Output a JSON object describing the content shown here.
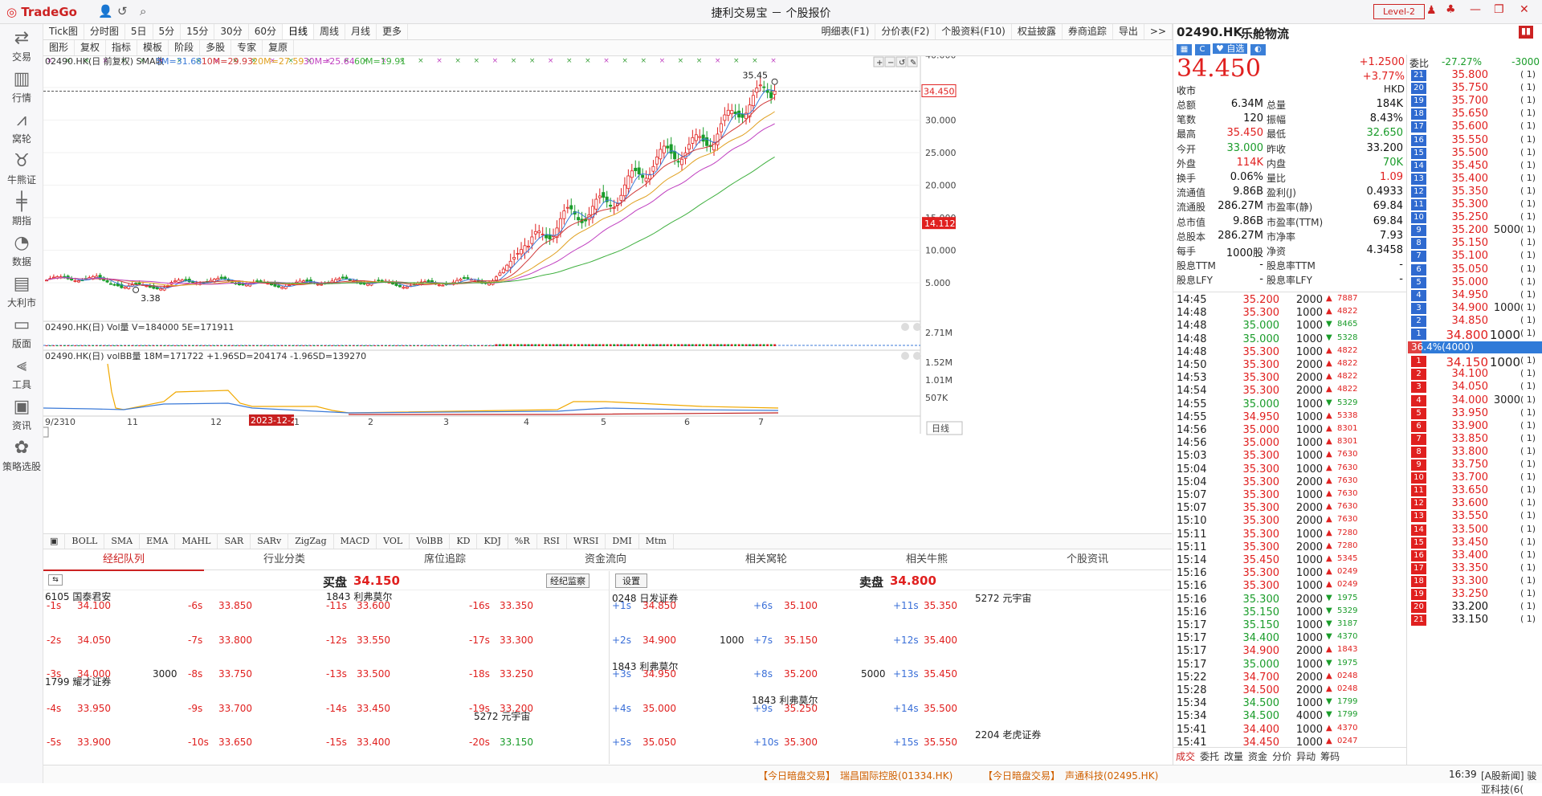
{
  "app": {
    "logo": "TradeGo",
    "title": "捷利交易宝 － 个股报价",
    "level": "Level-2"
  },
  "sidebar": [
    {
      "label": "交易",
      "icon": "trade-icon"
    },
    {
      "label": "行情",
      "icon": "market-icon"
    },
    {
      "label": "窝轮",
      "icon": "warrant-icon"
    },
    {
      "label": "牛熊证",
      "icon": "cbbc-icon"
    },
    {
      "label": "期指",
      "icon": "futures-icon"
    },
    {
      "label": "数据",
      "icon": "data-icon"
    },
    {
      "label": "大利市",
      "icon": "dalishi-icon"
    },
    {
      "label": "版面",
      "icon": "layout-icon"
    },
    {
      "label": "工具",
      "icon": "tools-icon"
    },
    {
      "label": "资讯",
      "icon": "news-icon"
    },
    {
      "label": "策略选股",
      "icon": "strategy-icon"
    }
  ],
  "period_tabs": [
    "Tick图",
    "分时图",
    "5日",
    "5分",
    "15分",
    "30分",
    "60分",
    "日线",
    "周线",
    "月线",
    "更多"
  ],
  "right_tabs": [
    "明细表(F1)",
    "分价表(F2)",
    "个股资料(F10)",
    "权益披露",
    "券商追踪",
    "导出",
    ">>"
  ],
  "tool_tabs": [
    "图形",
    "复权",
    "指标",
    "模板",
    "阶段",
    "多股",
    "专家",
    "复原"
  ],
  "chart": {
    "legend_main": "02490.HK(日 前复权) SMA收",
    "ma": [
      {
        "name": "5M=31.68",
        "color": "#3b7ad8"
      },
      {
        "name": "10M=29.93",
        "color": "#d03838"
      },
      {
        "name": "20M=27.59",
        "color": "#e0a020"
      },
      {
        "name": "30M=25.64",
        "color": "#c040c0"
      },
      {
        "name": "60M=19.91",
        "color": "#40b040"
      }
    ],
    "y_ticks": [
      "40.000",
      "35.000",
      "30.000",
      "25.000",
      "20.000",
      "15.000",
      "10.000",
      "5.000"
    ],
    "price_hi": "35.45",
    "price_lo": "3.38",
    "last_price_tag": "34.450",
    "marker_price": "14.112",
    "vol_legend": "02490.HK(日) Vol量 V=184000 5E=171911",
    "vol_tick": "2.71M",
    "volbb_legend": "02490.HK(日) volBB量 18M=171722 +1.96SD=204174 -1.96SD=139270",
    "volbb_ticks": [
      "1.52M",
      "1.01M",
      "507K"
    ],
    "x_ticks": [
      "9/23",
      "10",
      "11",
      "12",
      "2023-12-27",
      "1",
      "2",
      "3",
      "4",
      "5",
      "6",
      "7"
    ],
    "period_btn": "日线"
  },
  "indicator_tabs": [
    "BOLL",
    "SMA",
    "EMA",
    "MAHL",
    "SAR",
    "SARv",
    "ZigZag",
    "MACD",
    "VOL",
    "VolBB",
    "KD",
    "KDJ",
    "%R",
    "RSI",
    "WRSI",
    "DMI",
    "Mtm"
  ],
  "bottom_tabs": [
    "经纪队列",
    "行业分类",
    "席位追踪",
    "资金流向",
    "相关窝轮",
    "相关牛熊",
    "个股资讯"
  ],
  "queue": {
    "buy_title": "买盘",
    "buy_price": "34.150",
    "sell_title": "卖盘",
    "sell_price": "34.800",
    "monitor_btn": "经纪监察",
    "settings_btn": "设置",
    "buy_names": [
      "6105 国泰君安",
      "1843 利弗莫尔",
      "1799 耀才证券",
      "5272 元宇宙"
    ],
    "sell_names": [
      "0248 日发证券",
      "5272 元宇宙",
      "1843 利弗莫尔",
      "1843 利弗莫尔",
      "2204 老虎证券"
    ],
    "buy_cols": [
      [
        [
          "-1s",
          "34.100",
          ""
        ],
        [
          "-2s",
          "34.050",
          ""
        ],
        [
          "-3s",
          "34.000",
          "3000"
        ],
        [
          "-4s",
          "33.950",
          ""
        ],
        [
          "-5s",
          "33.900",
          ""
        ]
      ],
      [
        [
          "-6s",
          "33.850",
          ""
        ],
        [
          "-7s",
          "33.800",
          ""
        ],
        [
          "-8s",
          "33.750",
          ""
        ],
        [
          "-9s",
          "33.700",
          ""
        ],
        [
          "-10s",
          "33.650",
          ""
        ]
      ],
      [
        [
          "-11s",
          "33.600",
          ""
        ],
        [
          "-12s",
          "33.550",
          ""
        ],
        [
          "-13s",
          "33.500",
          ""
        ],
        [
          "-14s",
          "33.450",
          ""
        ],
        [
          "-15s",
          "33.400",
          ""
        ]
      ],
      [
        [
          "-16s",
          "33.350",
          ""
        ],
        [
          "-17s",
          "33.300",
          ""
        ],
        [
          "-18s",
          "33.250",
          ""
        ],
        [
          "-19s",
          "33.200",
          ""
        ],
        [
          "-20s",
          "33.150",
          ""
        ]
      ]
    ],
    "sell_cols": [
      [
        [
          "+1s",
          "34.850",
          ""
        ],
        [
          "+2s",
          "34.900",
          "1000"
        ],
        [
          "+3s",
          "34.950",
          ""
        ],
        [
          "+4s",
          "35.000",
          ""
        ],
        [
          "+5s",
          "35.050",
          ""
        ]
      ],
      [
        [
          "+6s",
          "35.100",
          ""
        ],
        [
          "+7s",
          "35.150",
          ""
        ],
        [
          "+8s",
          "35.200",
          "5000"
        ],
        [
          "+9s",
          "35.250",
          ""
        ],
        [
          "+10s",
          "35.300",
          ""
        ]
      ],
      [
        [
          "+11s",
          "35.350",
          ""
        ],
        [
          "+12s",
          "35.400",
          ""
        ],
        [
          "+13s",
          "35.450",
          ""
        ],
        [
          "+14s",
          "35.500",
          ""
        ],
        [
          "+15s",
          "35.550",
          ""
        ]
      ]
    ]
  },
  "ticker": [
    {
      "tag": "【今日暗盘交易】",
      "text": "瑞昌国际控股(01334.HK)"
    },
    {
      "tag": "【今日暗盘交易】",
      "text": "声通科技(02495.HK)"
    }
  ],
  "clock": "16:39",
  "news": "[A股新闻] 骏亚科技(6(",
  "quote": {
    "code": "02490.HK",
    "name": "乐舱物流",
    "price": "34.450",
    "chg": "+1.2500",
    "pct": "+3.77%",
    "status": "收市",
    "currency": "HKD",
    "btn_fav": "自选",
    "fields": [
      [
        "总额",
        "6.34M",
        "总量",
        "184K"
      ],
      [
        "笔数",
        "120",
        "振幅",
        "8.43%"
      ],
      [
        "最高",
        "35.450",
        "最低",
        "32.650"
      ],
      [
        "今开",
        "33.000",
        "昨收",
        "33.200"
      ],
      [
        "外盘",
        "114K",
        "内盘",
        "70K"
      ],
      [
        "换手",
        "0.06%",
        "量比",
        "1.09"
      ],
      [
        "流通值",
        "9.86B",
        "盈利(J)",
        "0.4933"
      ],
      [
        "流通股",
        "286.27M",
        "市盈率(静)",
        "69.84"
      ],
      [
        "总市值",
        "9.86B",
        "市盈率(TTM)",
        "69.84"
      ],
      [
        "总股本",
        "286.27M",
        "市净率",
        "7.93"
      ],
      [
        "每手",
        "1000股",
        "净资",
        "4.3458"
      ],
      [
        "股息TTM",
        "-",
        "股息率TTM",
        "-"
      ],
      [
        "股息LFY",
        "-",
        "股息率LFY",
        "-"
      ]
    ]
  },
  "trades": [
    [
      "14:45",
      "35.200",
      "2000",
      "u",
      "7887"
    ],
    [
      "14:48",
      "35.300",
      "1000",
      "u",
      "4822"
    ],
    [
      "14:48",
      "35.000",
      "1000",
      "d",
      "8465"
    ],
    [
      "14:48",
      "35.000",
      "1000",
      "d",
      "5328"
    ],
    [
      "14:48",
      "35.300",
      "1000",
      "u",
      "4822"
    ],
    [
      "14:50",
      "35.300",
      "2000",
      "u",
      "4822"
    ],
    [
      "14:53",
      "35.300",
      "2000",
      "u",
      "4822"
    ],
    [
      "14:54",
      "35.300",
      "2000",
      "u",
      "4822"
    ],
    [
      "14:55",
      "35.000",
      "1000",
      "d",
      "5329"
    ],
    [
      "14:55",
      "34.950",
      "1000",
      "u",
      "5338"
    ],
    [
      "14:56",
      "35.000",
      "1000",
      "u",
      "8301"
    ],
    [
      "14:56",
      "35.000",
      "1000",
      "u",
      "8301"
    ],
    [
      "15:03",
      "35.300",
      "1000",
      "u",
      "7630"
    ],
    [
      "15:04",
      "35.300",
      "1000",
      "u",
      "7630"
    ],
    [
      "15:04",
      "35.300",
      "2000",
      "u",
      "7630"
    ],
    [
      "15:07",
      "35.300",
      "1000",
      "u",
      "7630"
    ],
    [
      "15:07",
      "35.300",
      "2000",
      "u",
      "7630"
    ],
    [
      "15:10",
      "35.300",
      "2000",
      "u",
      "7630"
    ],
    [
      "15:11",
      "35.300",
      "1000",
      "u",
      "7280"
    ],
    [
      "15:11",
      "35.300",
      "2000",
      "u",
      "7280"
    ],
    [
      "15:14",
      "35.450",
      "1000",
      "u",
      "5345"
    ],
    [
      "15:16",
      "35.300",
      "1000",
      "u",
      "0249"
    ],
    [
      "15:16",
      "35.300",
      "1000",
      "u",
      "0249"
    ],
    [
      "15:16",
      "35.300",
      "2000",
      "d",
      "1975"
    ],
    [
      "15:16",
      "35.150",
      "1000",
      "d",
      "5329"
    ],
    [
      "15:17",
      "35.150",
      "1000",
      "d",
      "3187"
    ],
    [
      "15:17",
      "34.400",
      "1000",
      "d",
      "4370"
    ],
    [
      "15:17",
      "34.900",
      "2000",
      "u",
      "1843"
    ],
    [
      "15:17",
      "35.000",
      "1000",
      "d",
      "1975"
    ],
    [
      "15:22",
      "34.700",
      "2000",
      "u",
      "0248"
    ],
    [
      "15:28",
      "34.500",
      "2000",
      "u",
      "0248"
    ],
    [
      "15:34",
      "34.500",
      "1000",
      "d",
      "1799"
    ],
    [
      "15:34",
      "34.500",
      "4000",
      "d",
      "1799"
    ],
    [
      "15:41",
      "34.400",
      "1000",
      "u",
      "4370"
    ],
    [
      "15:41",
      "34.450",
      "1000",
      "u",
      "0247"
    ]
  ],
  "trade_tabs": [
    "成交",
    "委托",
    "改量",
    "资金",
    "分价",
    "异动",
    "筹码"
  ],
  "book": {
    "ratio_lbl": "委比",
    "ratio_pct": "-27.27%",
    "ratio_val": "-3000",
    "asks": [
      [
        "21",
        "35.800",
        ""
      ],
      [
        "20",
        "35.750",
        ""
      ],
      [
        "19",
        "35.700",
        ""
      ],
      [
        "18",
        "35.650",
        ""
      ],
      [
        "17",
        "35.600",
        ""
      ],
      [
        "16",
        "35.550",
        ""
      ],
      [
        "15",
        "35.500",
        ""
      ],
      [
        "14",
        "35.450",
        ""
      ],
      [
        "13",
        "35.400",
        ""
      ],
      [
        "12",
        "35.350",
        ""
      ],
      [
        "11",
        "35.300",
        ""
      ],
      [
        "10",
        "35.250",
        ""
      ],
      [
        "9",
        "35.200",
        "5000"
      ],
      [
        "8",
        "35.150",
        ""
      ],
      [
        "7",
        "35.100",
        ""
      ],
      [
        "6",
        "35.050",
        ""
      ],
      [
        "5",
        "35.000",
        ""
      ],
      [
        "4",
        "34.950",
        ""
      ],
      [
        "3",
        "34.900",
        "1000"
      ],
      [
        "2",
        "34.850",
        ""
      ],
      [
        "1",
        "34.800",
        "1000"
      ]
    ],
    "mid": "36.4%(4000)",
    "bids": [
      [
        "1",
        "34.150",
        "1000"
      ],
      [
        "2",
        "34.100",
        ""
      ],
      [
        "3",
        "34.050",
        ""
      ],
      [
        "4",
        "34.000",
        "3000"
      ],
      [
        "5",
        "33.950",
        ""
      ],
      [
        "6",
        "33.900",
        ""
      ],
      [
        "7",
        "33.850",
        ""
      ],
      [
        "8",
        "33.800",
        ""
      ],
      [
        "9",
        "33.750",
        ""
      ],
      [
        "10",
        "33.700",
        ""
      ],
      [
        "11",
        "33.650",
        ""
      ],
      [
        "12",
        "33.600",
        ""
      ],
      [
        "13",
        "33.550",
        ""
      ],
      [
        "14",
        "33.500",
        ""
      ],
      [
        "15",
        "33.450",
        ""
      ],
      [
        "16",
        "33.400",
        ""
      ],
      [
        "17",
        "33.350",
        ""
      ],
      [
        "18",
        "33.300",
        ""
      ],
      [
        "19",
        "33.250",
        ""
      ],
      [
        "20",
        "33.200",
        ""
      ],
      [
        "21",
        "33.150",
        ""
      ]
    ]
  }
}
